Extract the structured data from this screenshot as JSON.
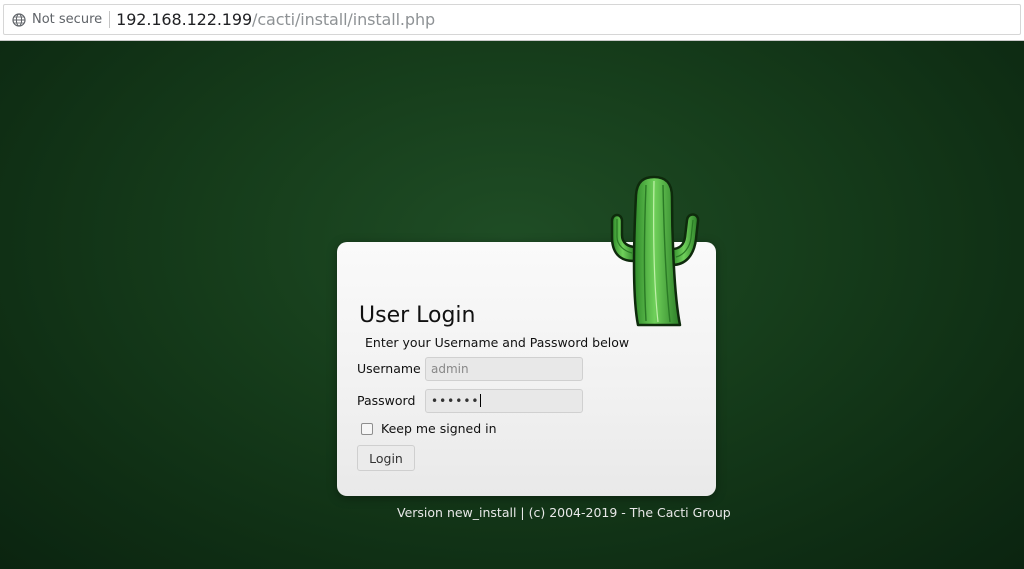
{
  "browser": {
    "security_label": "Not secure",
    "url_host": "192.168.122.199",
    "url_path": "/cacti/install/install.php"
  },
  "login": {
    "title": "User Login",
    "subtitle": "Enter your Username and Password below",
    "username_label": "Username",
    "username_value": "admin",
    "password_label": "Password",
    "password_masked": "••••••",
    "remember_label": "Keep me signed in",
    "remember_checked": false,
    "button_label": "Login"
  },
  "footer": {
    "text": "Version new_install | (c) 2004-2019 - The Cacti Group"
  },
  "icons": {
    "globe": "globe-icon",
    "logo": "cactus-logo-icon"
  },
  "colors": {
    "background": "#163d1b",
    "card": "#f1f1f1"
  }
}
